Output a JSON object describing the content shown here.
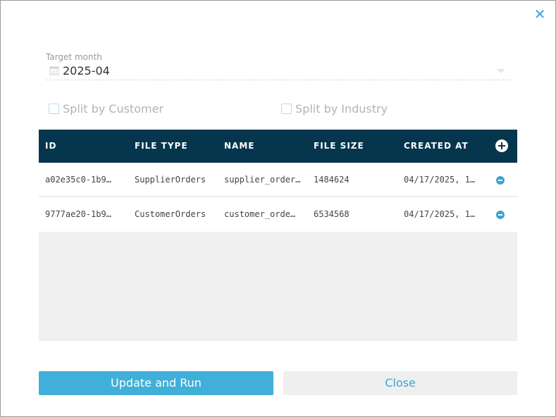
{
  "dialog": {
    "close_icon": "close-icon"
  },
  "target_month": {
    "label": "Target month",
    "value": "2025-04",
    "icon": "calendar-icon"
  },
  "options": {
    "split_by_customer": {
      "label": "Split by Customer",
      "checked": false
    },
    "split_by_industry": {
      "label": "Split by Industry",
      "checked": false
    }
  },
  "table": {
    "columns": [
      "ID",
      "FILE TYPE",
      "NAME",
      "FILE SIZE",
      "CREATED AT"
    ],
    "add_icon": "plus-circle-icon",
    "rows": [
      {
        "id": "a02e35c0-1b9…",
        "file_type": "SupplierOrders",
        "name": "supplier_order…",
        "file_size": "1484624",
        "created_at": "04/17/2025, 1…"
      },
      {
        "id": "9777ae20-1b9…",
        "file_type": "CustomerOrders",
        "name": "customer_orde…",
        "file_size": "6534568",
        "created_at": "04/17/2025, 1…"
      }
    ]
  },
  "actions": {
    "primary_label": "Update and Run",
    "secondary_label": "Close"
  },
  "colors": {
    "header_bg": "#06364e",
    "accent": "#40afd9"
  }
}
